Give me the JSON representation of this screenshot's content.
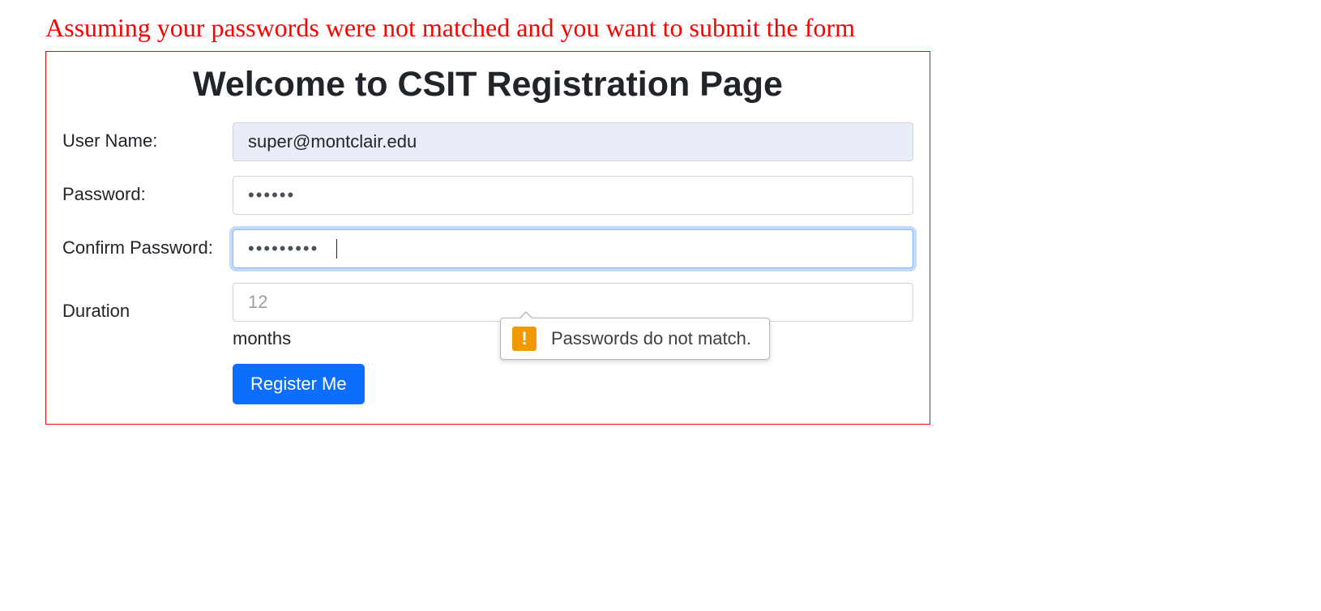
{
  "instruction_text": "Assuming your passwords were not matched and you want to submit the form",
  "page_title": "Welcome to CSIT Registration Page",
  "form": {
    "username_label": "User Name:",
    "username_value": "super@montclair.edu",
    "password_label": "Password:",
    "password_value": "••••••",
    "confirm_label": "Confirm Password:",
    "confirm_value": "•••••••••",
    "duration_label": "Duration",
    "duration_value": "12",
    "duration_help": "months",
    "submit_label": "Register Me"
  },
  "validation_tooltip": "Passwords do not match."
}
